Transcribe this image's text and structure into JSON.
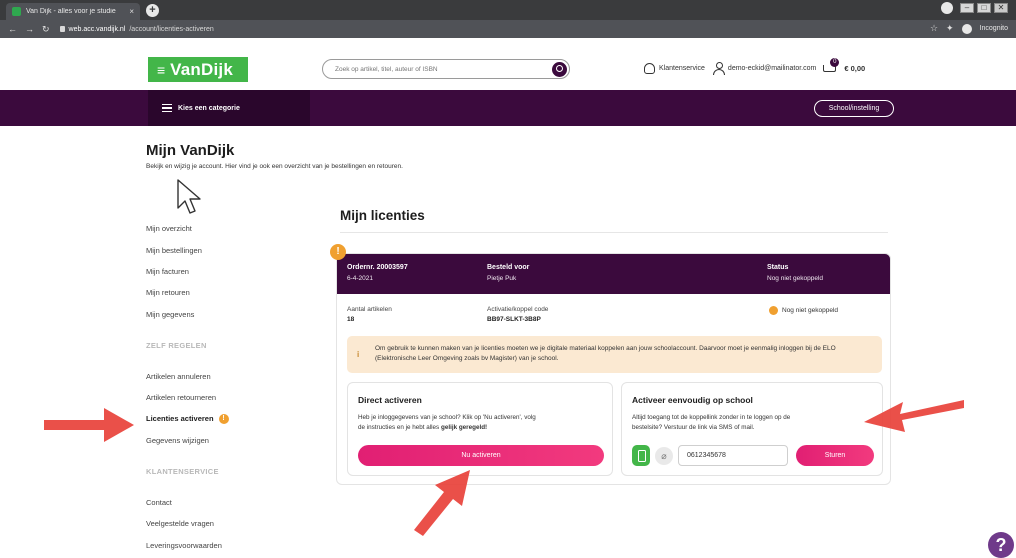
{
  "browser": {
    "tab_title": "Van Dijk - alles voor je studie",
    "tab_close": "×",
    "new_tab": "+",
    "url_host": "web.acc.vandijk.nl",
    "url_path": "/account/licenties-activeren",
    "incognito_label": "Incognito",
    "win_minimize": "–",
    "win_maximize": "□",
    "win_close": "✕"
  },
  "header": {
    "logo_text": "VanDijk",
    "logo_icon": "≡",
    "search_placeholder": "Zoek op artikel, titel, auteur of ISBN",
    "customer_service": "Klantenservice",
    "user_email": "demo-eckid@mailinator.com",
    "cart_count": "0",
    "cart_total": "€ 0,00"
  },
  "nav": {
    "category_label": "Kies een categorie",
    "school_button": "School/instelling"
  },
  "page": {
    "title": "Mijn VanDijk",
    "subtitle": "Bekijk en wijzig je account. Hier vind je ook een overzicht van je bestellingen en retouren."
  },
  "sidebar": {
    "items": [
      {
        "label": "Mijn overzicht"
      },
      {
        "label": "Mijn bestellingen"
      },
      {
        "label": "Mijn facturen"
      },
      {
        "label": "Mijn retouren"
      },
      {
        "label": "Mijn gegevens"
      }
    ],
    "section_zelf": "ZELF REGELEN",
    "zelf_items": [
      {
        "label": "Artikelen annuleren"
      },
      {
        "label": "Artikelen retourneren"
      },
      {
        "label": "Licenties activeren"
      },
      {
        "label": "Gegevens wijzigen"
      }
    ],
    "active_badge": "!",
    "section_klant": "KLANTENSERVICE",
    "klant_items": [
      {
        "label": "Contact"
      },
      {
        "label": "Veelgestelde vragen"
      },
      {
        "label": "Leveringsvoorwaarden"
      }
    ]
  },
  "content": {
    "title": "Mijn licenties",
    "warn_badge": "!",
    "order": {
      "order_label": "Ordernr. 20003597",
      "order_date": "6-4-2021",
      "ordered_for_label": "Besteld voor",
      "ordered_for_value": "Pietje Puk",
      "status_label": "Status",
      "status_value": "Nog niet gekoppeld",
      "articles_label": "Aantal artikelen",
      "articles_value": "18",
      "code_label": "Activatie/koppel code",
      "code_value": "BB97-SLKT-3B8P",
      "status_pill": "Nog niet gekoppeld"
    },
    "info": {
      "icon": "i",
      "text": "Om gebruik te kunnen maken van je licenties moeten we je digitale materiaal koppelen aan jouw schoolaccount. Daarvoor moet je eenmalig inloggen bij de ELO (Elektronische Leer Omgeving zoals bv Magister) van je school."
    },
    "direct": {
      "title": "Direct activeren",
      "text_1": "Heb je inloggegevens van je school? Klik op 'Nu activeren', volg",
      "text_2": "de instructies en je hebt alles",
      "text_bold": "gelijk geregeld!",
      "button": "Nu activeren"
    },
    "school": {
      "title": "Activeer eenvoudig op school",
      "text_1": "Altijd toegang tot de koppellink zonder in te loggen op de",
      "text_2": "bestelsite? Verstuur de link via SMS of mail.",
      "link_icon": "⌀",
      "phone_value": "0612345678",
      "button": "Sturen"
    }
  },
  "help_label": "?",
  "colors": {
    "brand_green": "#43b649",
    "brand_purple": "#3b0a3d",
    "cta_pink": "#e11f73",
    "warning_orange": "#f0a030",
    "annotation_red": "#e8413a"
  }
}
